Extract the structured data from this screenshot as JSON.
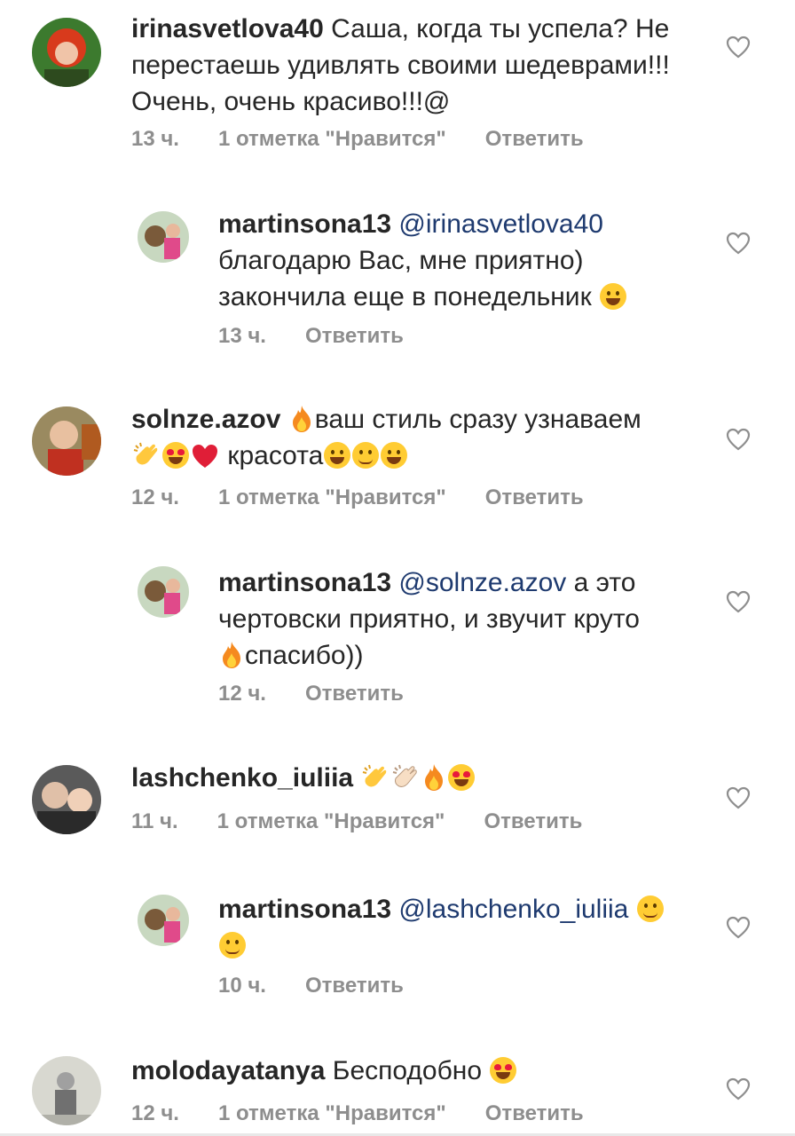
{
  "comments": [
    {
      "user": "irinasvetlova40",
      "text": " Саша, когда ты успела? Не перестаешь удивлять своими шедеврами!!! Очень, очень красиво!!!@",
      "time": "13 ч.",
      "likes": "1 отметка \"Нравится\"",
      "reply_label": "Ответить"
    },
    {
      "user": "martinsona13",
      "mention": "@irinasvetlova40",
      "text": "благодарю Вас, мне приятно) закончила еще в понедельник",
      "time": "13 ч.",
      "reply_label": "Ответить"
    },
    {
      "user": "solnze.azov",
      "text": "ваш стиль сразу узнаваем",
      "text2": "красота",
      "time": "12 ч.",
      "likes": "1 отметка \"Нравится\"",
      "reply_label": "Ответить"
    },
    {
      "user": "martinsona13",
      "mention": "@solnze.azov",
      "text": " а это чертовски приятно, и звучит круто",
      "text2": "спасибо))",
      "time": "12 ч.",
      "reply_label": "Ответить"
    },
    {
      "user": "lashchenko_iuliia",
      "time": "11 ч.",
      "likes": "1 отметка \"Нравится\"",
      "reply_label": "Ответить"
    },
    {
      "user": "martinsona13",
      "mention": "@lashchenko_iuliia",
      "time": "10 ч.",
      "reply_label": "Ответить"
    },
    {
      "user": "molodayatanya",
      "text": " Бесподобно",
      "time": "12 ч.",
      "likes": "1 отметка \"Нравится\"",
      "reply_label": "Ответить"
    }
  ],
  "icons": {
    "like": "heart-outline-icon",
    "accent_mention": "#1e3a6f",
    "meta_color": "#8e8e8e"
  }
}
